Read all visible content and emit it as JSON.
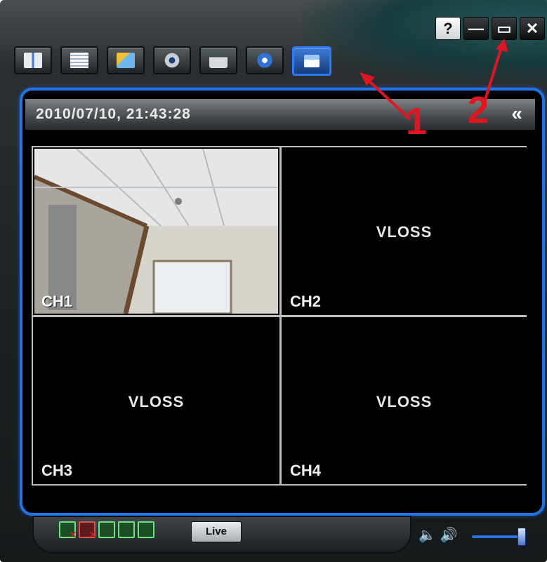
{
  "window": {
    "controls": [
      {
        "name": "help",
        "label": "?"
      },
      {
        "name": "minimize",
        "label": "—"
      },
      {
        "name": "maximize",
        "label": "▭"
      },
      {
        "name": "close",
        "label": "✕"
      }
    ]
  },
  "toolbar": {
    "buttons": [
      {
        "name": "address-book",
        "icon": "book-icon"
      },
      {
        "name": "record-list",
        "icon": "document-stack-icon"
      },
      {
        "name": "search",
        "icon": "search-image-icon"
      },
      {
        "name": "settings",
        "icon": "gear-icon"
      },
      {
        "name": "remote-config",
        "icon": "camera-icon"
      },
      {
        "name": "information",
        "icon": "info-icon"
      },
      {
        "name": "live-window",
        "icon": "hand-pointer-icon",
        "active": true
      }
    ]
  },
  "viewer": {
    "datetime": "2010/07/10, 21:43:28",
    "collapse_label": "«",
    "channels": [
      {
        "label": "CH1",
        "status": ""
      },
      {
        "label": "CH2",
        "status": "VLOSS"
      },
      {
        "label": "CH3",
        "status": "VLOSS"
      },
      {
        "label": "CH4",
        "status": "VLOSS"
      }
    ]
  },
  "bottom_bar": {
    "live_label": "Live",
    "layout_buttons": [
      "layout-quad-close-icon",
      "layout-single-close-icon",
      "layout-cascade-icon",
      "layout-full-icon",
      "layout-square-icon"
    ],
    "volume": 0.95
  },
  "annotations": [
    {
      "number": "1"
    },
    {
      "number": "2"
    }
  ],
  "colors": {
    "accent": "#1f74e8",
    "annotation": "#e0151d"
  }
}
